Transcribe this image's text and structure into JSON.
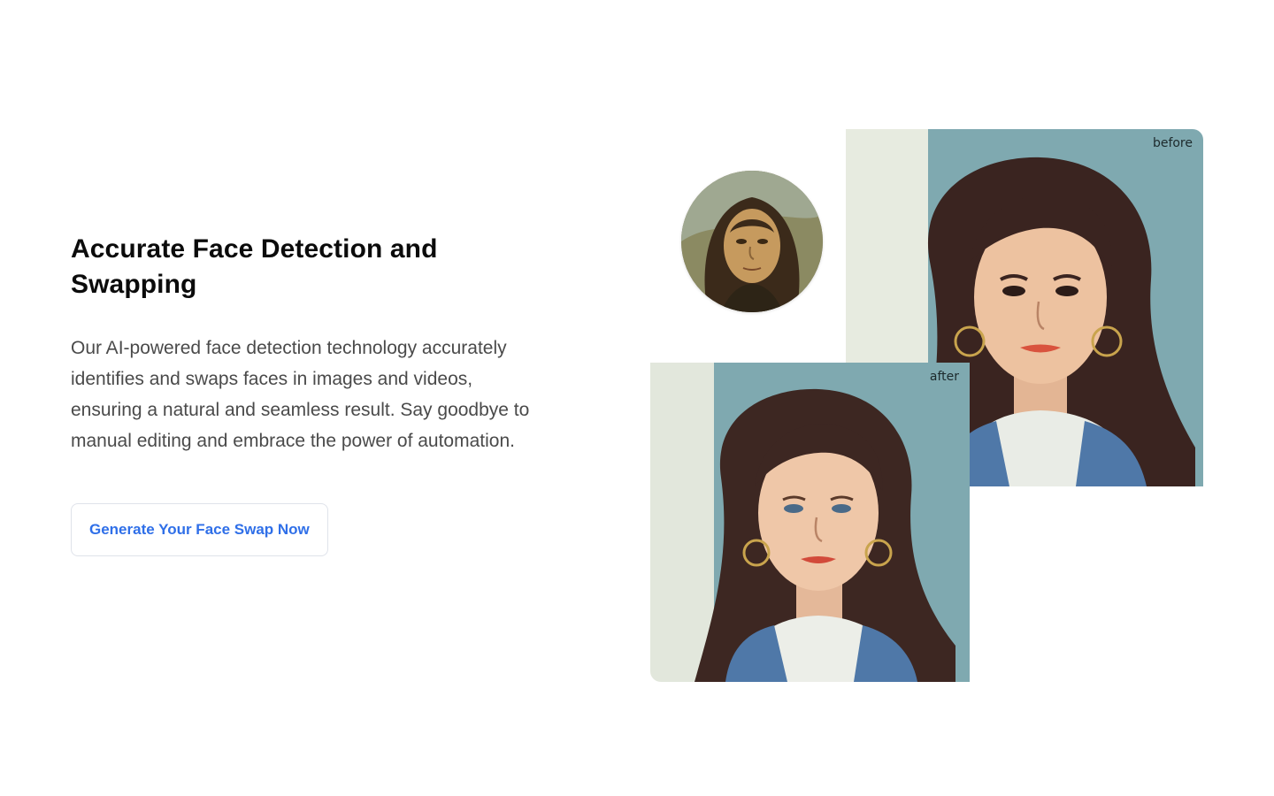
{
  "section": {
    "title": "Accurate Face Detection and Swapping",
    "description": "Our AI-powered face detection technology accurately identifies and swaps faces in images and videos, ensuring a natural and seamless result. Say goodbye to manual editing and embrace the power of automation.",
    "cta_label": "Generate Your Face Swap Now"
  },
  "visual": {
    "before_label": "before",
    "after_label": "after"
  },
  "colors": {
    "accent": "#2f6fe8",
    "title_text": "#0b0b0b",
    "body_text": "#4a4a4a",
    "button_border": "#dfe3ea"
  }
}
